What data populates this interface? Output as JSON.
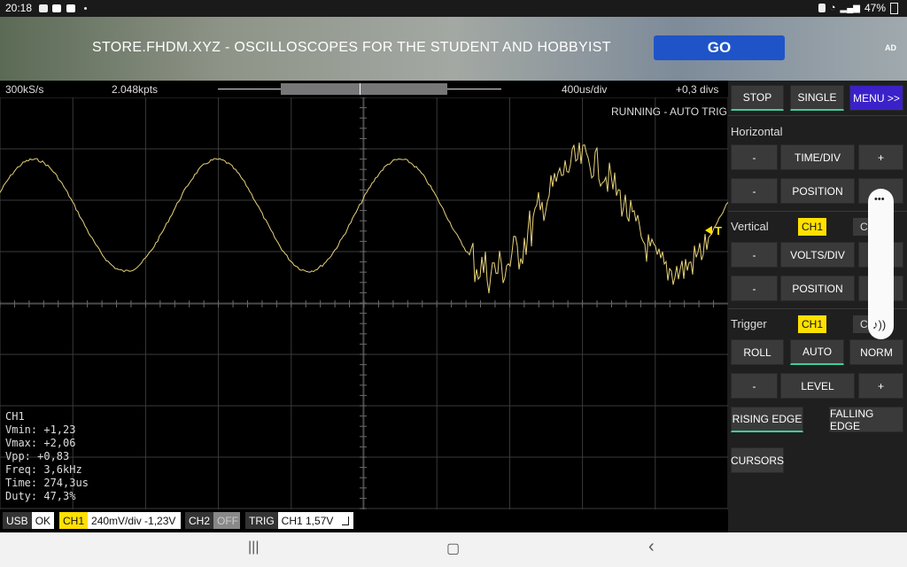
{
  "status_bar": {
    "time": "20:18",
    "battery": "47%",
    "icons": [
      "image-icon",
      "youtube-icon",
      "youtube-icon",
      "dot-icon",
      "lock-icon",
      "wifi-icon",
      "signal-icon",
      "battery-icon"
    ]
  },
  "ad": {
    "text": "STORE.FHDM.XYZ - OSCILLOSCOPES FOR THE STUDENT AND HOBBYIST",
    "go_label": "GO",
    "ad_label": "AD",
    "go_color": "#1f54c8"
  },
  "info_bar": {
    "sample_rate": "300kS/s",
    "points": "2.048kpts",
    "time_div": "400us/div",
    "offset": "+0,3 divs"
  },
  "scope": {
    "status": "RUNNING - AUTO TRIG",
    "trigger_marker": "T",
    "trace_color": "#e8d27a",
    "measurements": {
      "channel": "CH1",
      "vmin": "Vmin: +1,23",
      "vmax": "Vmax: +2,06",
      "vpp": "Vpp: +0,83",
      "freq": "Freq: 3,6kHz",
      "time": "Time: 274,3us",
      "duty": "Duty: 47,3%"
    }
  },
  "bottom_bar": {
    "usb_key": "USB",
    "usb_val": "OK",
    "ch1_key": "CH1",
    "ch1_val": "240mV/div  -1,23V",
    "ch2_key": "CH2",
    "ch2_val": "OFF",
    "trig_key": "TRIG",
    "trig_val": "CH1  1,57V"
  },
  "panel": {
    "stop": "STOP",
    "single": "SINGLE",
    "menu": "MENU >>",
    "horizontal": "Horizontal",
    "minus": "-",
    "plus": "+",
    "time_div": "TIME/DIV",
    "position": "POSITION",
    "vertical": "Vertical",
    "ch1": "CH1",
    "ch2": "CH2",
    "volts_div": "VOLTS/DIV",
    "trigger": "Trigger",
    "roll": "ROLL",
    "auto": "AUTO",
    "norm": "NORM",
    "level": "LEVEL",
    "rising": "RISING EDGE",
    "falling": "FALLING EDGE",
    "cursors": "CURSORS",
    "accent": "#3ccf9d",
    "ch_color": "#ffe000",
    "menu_color": "#3a21c9"
  },
  "volume_popup": {
    "more": "•••",
    "sound": "♪))"
  },
  "nav_bar": {
    "recents": "|||",
    "home": "▢",
    "back": "‹"
  }
}
